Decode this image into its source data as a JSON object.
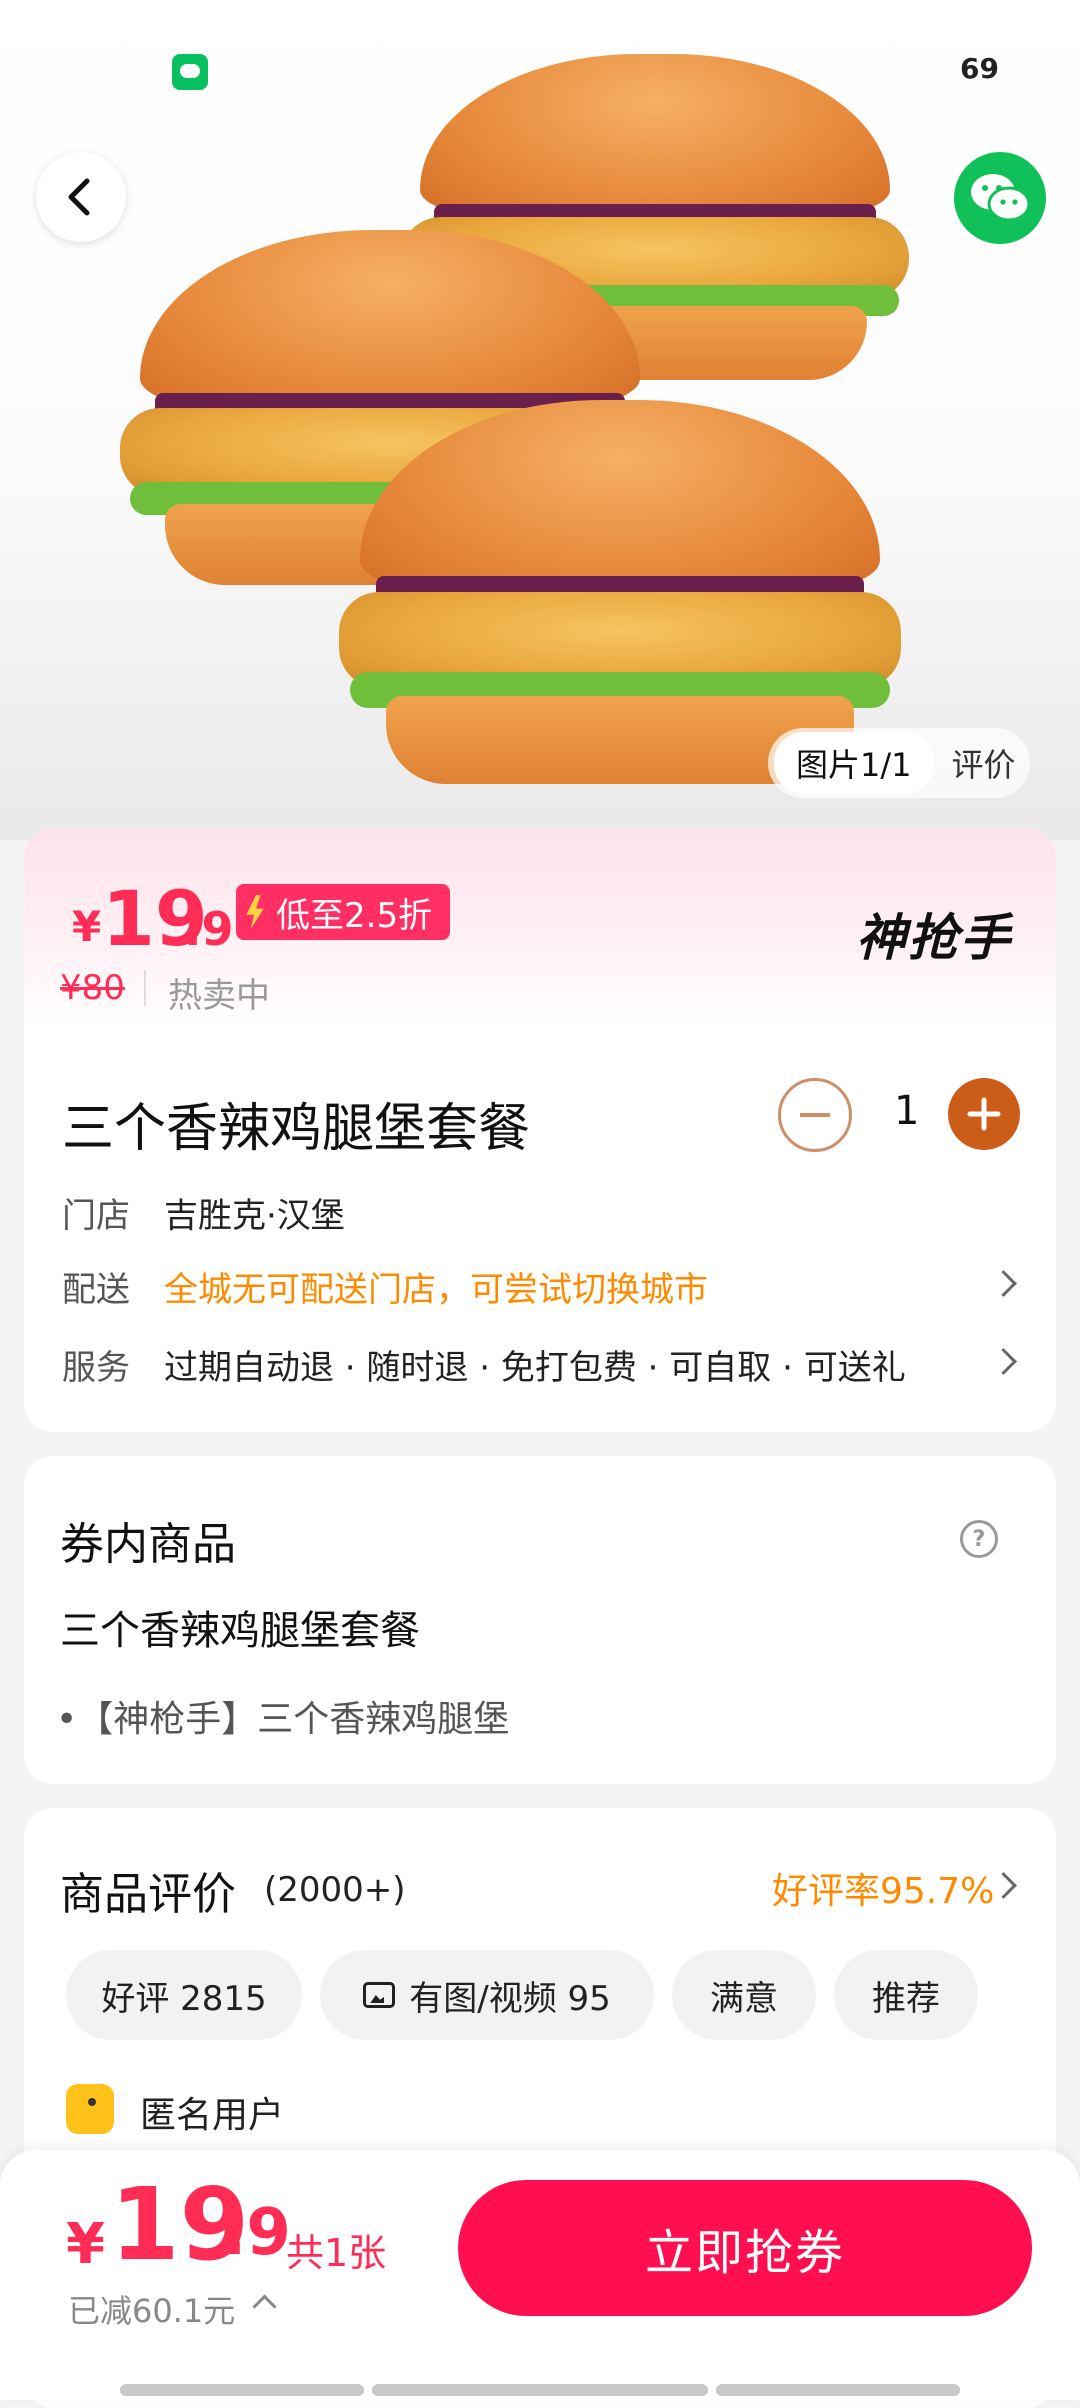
{
  "status": {
    "time": "69"
  },
  "hero": {
    "pager": "图片1/1",
    "review_tab": "评价"
  },
  "deal": {
    "currency": "¥",
    "price_int": "19",
    "price_dec": ".9",
    "discount": "低至2.5折",
    "brand": "神抢手",
    "original_price": "¥80",
    "sale_status": "热卖中",
    "title": "三个香辣鸡腿堡套餐",
    "quantity": "1",
    "store_label": "门店",
    "store_value": "吉胜克·汉堡",
    "delivery_label": "配送",
    "delivery_value": "全城无可配送门店，可尝试切换城市",
    "service_label": "服务",
    "service_value": "过期自动退 · 随时退 · 免打包费 · 可自取 · 可送礼"
  },
  "voucher": {
    "heading": "券内商品",
    "help": "?",
    "item_title": "三个香辣鸡腿堡套餐",
    "item_detail": "•【神枪手】三个香辣鸡腿堡"
  },
  "reviews": {
    "heading": "商品评价",
    "count": "(2000+)",
    "rating": "好评率95.7%",
    "filters": {
      "good": "好评 2815",
      "media": "有图/视频 95",
      "satisfied": "满意",
      "recommend": "推荐"
    },
    "first_user": "匿名用户"
  },
  "bottom": {
    "currency": "¥",
    "price_int": "19",
    "price_dec": ".9",
    "count": "共1张",
    "saved": "已减60.1元",
    "buy_label": "立即抢券"
  }
}
